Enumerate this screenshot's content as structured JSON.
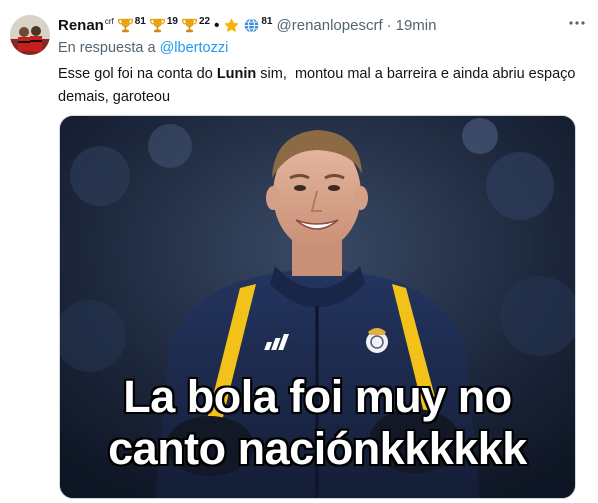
{
  "author": {
    "display_name": "Renan",
    "name_suffix": "crf",
    "badges": [
      {
        "icon": "trophy-icon",
        "count": "81"
      },
      {
        "icon": "trophy-icon",
        "count": "19"
      },
      {
        "icon": "trophy-icon",
        "count": "22"
      }
    ],
    "star_icon": "star-icon",
    "globe_badge": {
      "icon": "globe-icon",
      "count": "81"
    },
    "handle": "@renanlopescrf",
    "separator": "·",
    "timestamp": "19min"
  },
  "reply_to": {
    "prefix": "En respuesta a",
    "mention": "@lbertozzi"
  },
  "tweet_text": {
    "part1": "Esse gol foi na conta do ",
    "bold": "Lunin",
    "part2": " sim,  montou mal a barreira e ainda abriu espaço demais, garoteou"
  },
  "media": {
    "caption_line1": "La bola foi muy no",
    "caption_line2": "canto naciónkkkkkk"
  },
  "colors": {
    "link": "#1d9bf0",
    "secondary_text": "#536471",
    "primary_text": "#0f1419",
    "trophy": "#e8a317",
    "jacket": "#1c2a4d",
    "jacket_stripe": "#f2c21b"
  }
}
